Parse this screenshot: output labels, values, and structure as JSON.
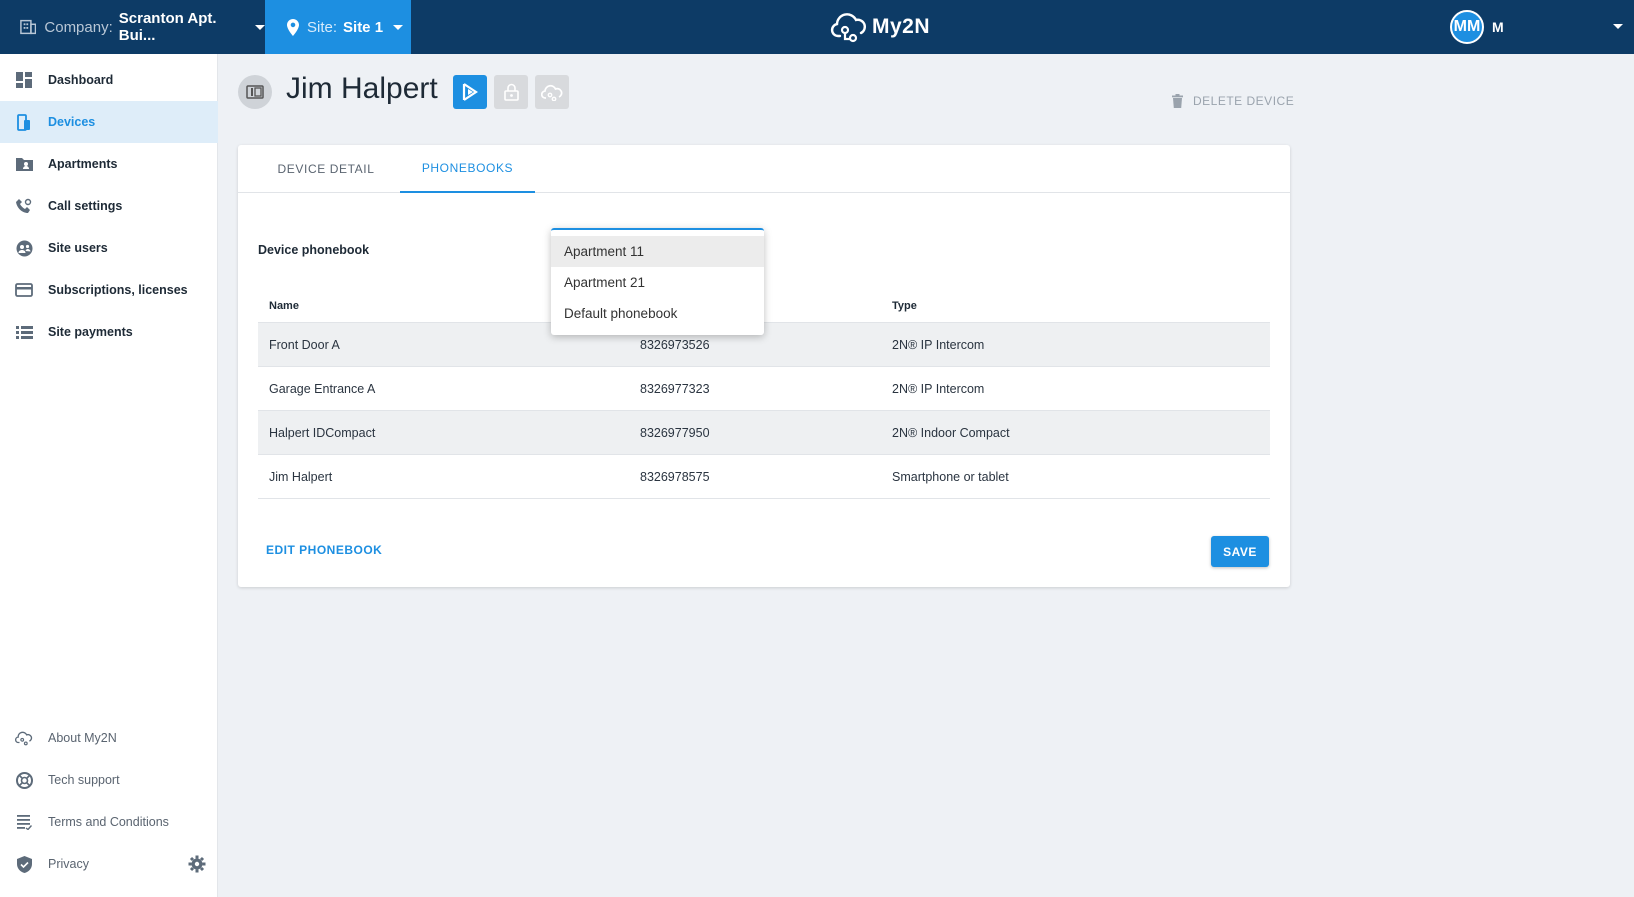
{
  "topbar": {
    "company_label": "Company:",
    "company_value": "Scranton Apt. Bui...",
    "site_label": "Site:",
    "site_value": "Site 1",
    "brand": "My2N",
    "user_initials": "MM",
    "user_name": "M"
  },
  "sidebar": {
    "items": [
      {
        "label": "Dashboard",
        "icon": "dashboard-icon"
      },
      {
        "label": "Devices",
        "icon": "devices-icon"
      },
      {
        "label": "Apartments",
        "icon": "apartments-icon"
      },
      {
        "label": "Call settings",
        "icon": "phone-settings-icon"
      },
      {
        "label": "Site users",
        "icon": "site-users-icon"
      },
      {
        "label": "Subscriptions, licenses",
        "icon": "credit-card-icon"
      },
      {
        "label": "Site payments",
        "icon": "list-icon"
      }
    ],
    "bottom_items": [
      {
        "label": "About My2N",
        "icon": "cloud-icon"
      },
      {
        "label": "Tech support",
        "icon": "lifebuoy-icon"
      },
      {
        "label": "Terms and Conditions",
        "icon": "document-icon"
      },
      {
        "label": "Privacy",
        "icon": "shield-icon"
      }
    ]
  },
  "device": {
    "title": "Jim Halpert",
    "delete_label": "DELETE DEVICE"
  },
  "tabs": [
    "DEVICE DETAIL",
    "PHONEBOOKS"
  ],
  "phonebook": {
    "label": "Device phonebook",
    "options": [
      "Apartment 11",
      "Apartment 21",
      "Default phonebook"
    ],
    "selected": "Apartment 11"
  },
  "table": {
    "headers": [
      "Name",
      "",
      "Type"
    ],
    "rows": [
      {
        "name": "Front Door A",
        "number": "8326973526",
        "type": "2N® IP Intercom"
      },
      {
        "name": "Garage Entrance A",
        "number": "8326977323",
        "type": "2N® IP Intercom"
      },
      {
        "name": "Halpert IDCompact",
        "number": "8326977950",
        "type": "2N® Indoor Compact"
      },
      {
        "name": "Jim Halpert",
        "number": "8326978575",
        "type": "Smartphone or tablet"
      }
    ]
  },
  "actions": {
    "edit_phonebook": "EDIT PHONEBOOK",
    "save": "SAVE"
  },
  "colors": {
    "topbar": "#0d3b66",
    "accent": "#1d8fe1"
  }
}
